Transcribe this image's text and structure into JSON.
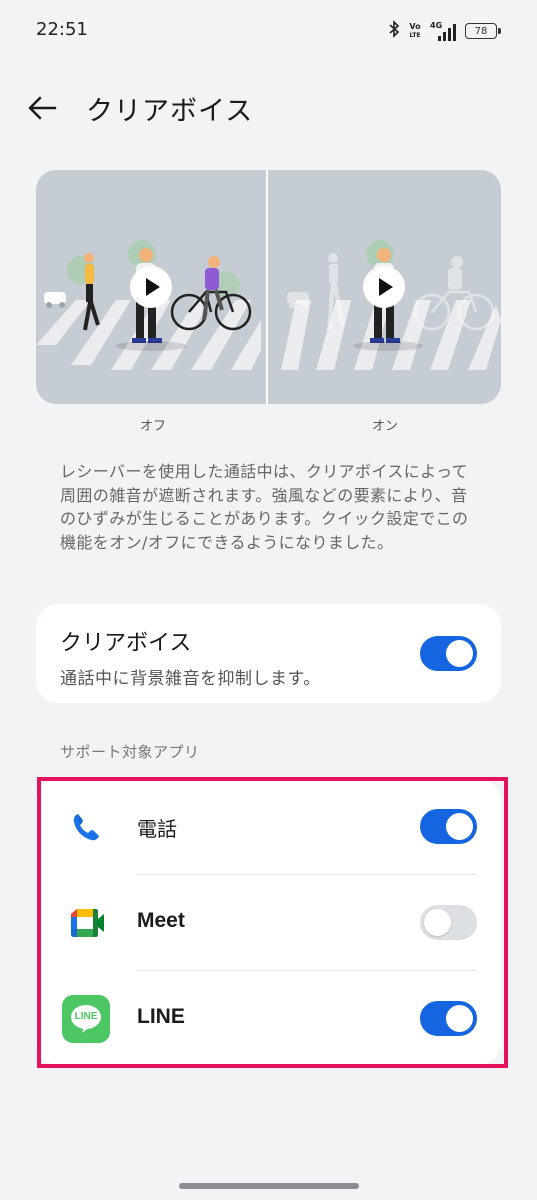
{
  "status_bar": {
    "time": "22:51",
    "volte_top": "Vo",
    "volte_bottom": "LTE",
    "network": "4G",
    "battery": "78",
    "icons": [
      "bluetooth-icon",
      "volte-icon",
      "signal-icon",
      "battery-icon"
    ]
  },
  "header": {
    "back_icon": "arrow-left-icon",
    "title": "クリアボイス"
  },
  "illustration": {
    "label_off": "オフ",
    "label_on": "オン",
    "play_icon": "play-icon"
  },
  "description": "レシーバーを使用した通話中は、クリアボイスによって周囲の雑音が遮断されます。強風などの要素により、音のひずみが生じることがあります。クイック設定でこの機能をオン/オフにできるようになりました。",
  "main_setting": {
    "title": "クリアボイス",
    "subtitle": "通話中に背景雑音を抑制します。",
    "enabled": true
  },
  "apps_section": {
    "label": "サポート対象アプリ",
    "apps": [
      {
        "name": "電話",
        "icon": "phone-icon",
        "enabled": true
      },
      {
        "name": "Meet",
        "icon": "meet-icon",
        "enabled": false
      },
      {
        "name": "LINE",
        "icon": "line-icon",
        "icon_text": "LINE",
        "enabled": true
      }
    ]
  },
  "colors": {
    "accent": "#1565e0",
    "highlight": "#e4115f",
    "background": "#f1f3f5"
  }
}
